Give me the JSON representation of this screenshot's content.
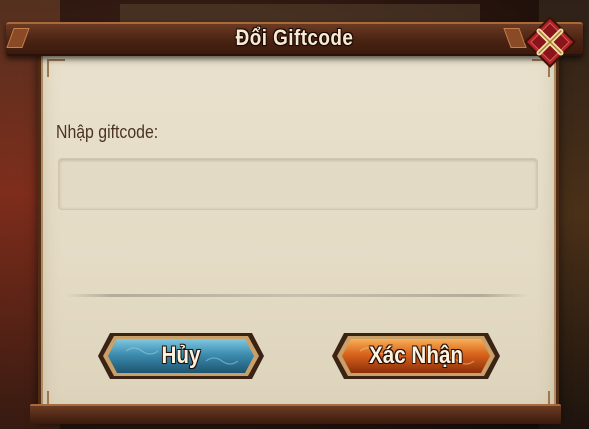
{
  "dialog": {
    "title": "Đổi Giftcode",
    "input_label": "Nhập giftcode:",
    "input_value": "",
    "input_placeholder": "",
    "cancel_label": "Hủy",
    "confirm_label": "Xác Nhận"
  },
  "icons": {
    "close": "close-icon"
  },
  "colors": {
    "cancel_button": "#3d8db0",
    "confirm_button": "#d9631c",
    "panel_background": "#e6ddc8",
    "frame": "#4e2c16",
    "close_badge": "#b2202a"
  }
}
